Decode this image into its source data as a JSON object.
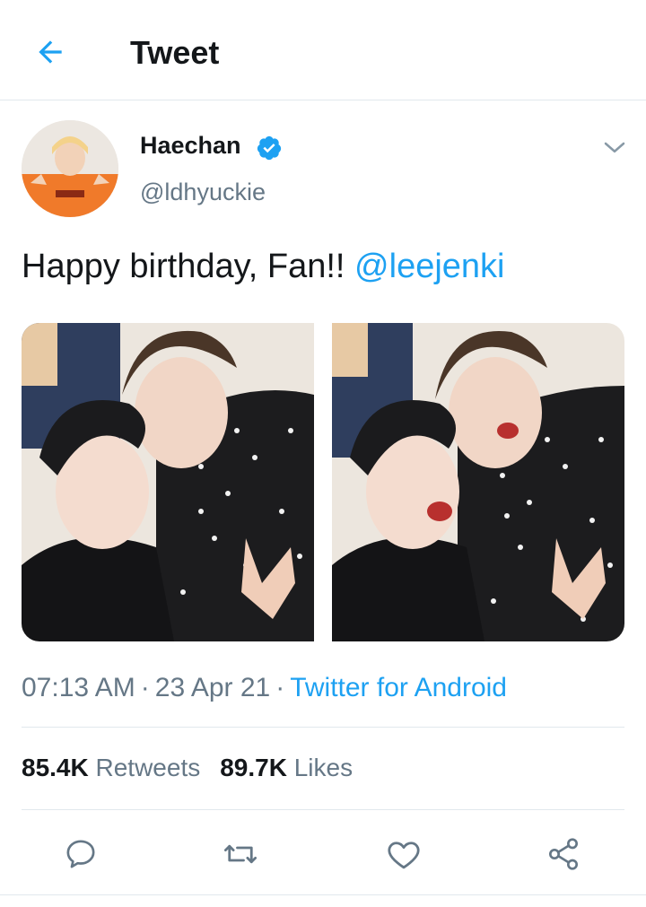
{
  "header": {
    "title": "Tweet",
    "back_icon": "arrow-left-icon"
  },
  "tweet": {
    "author_name": "Haechan",
    "author_handle": "@ldhyuckie",
    "verified": true,
    "text_prefix": "Happy birthday, Fan!! ",
    "mention": "@leejenki",
    "time": "07:13 AM",
    "date": "23 Apr 21",
    "source": "Twitter for Android",
    "separator": "·"
  },
  "stats": {
    "retweets_count": "85.4K",
    "retweets_label": "Retweets",
    "likes_count": "89.7K",
    "likes_label": "Likes"
  },
  "actions": [
    "reply-icon",
    "retweet-icon",
    "like-icon",
    "share-icon"
  ],
  "colors": {
    "accent": "#1da1f2",
    "text": "#14171a",
    "secondary_text": "#657786",
    "divider": "#e1e8ed"
  }
}
